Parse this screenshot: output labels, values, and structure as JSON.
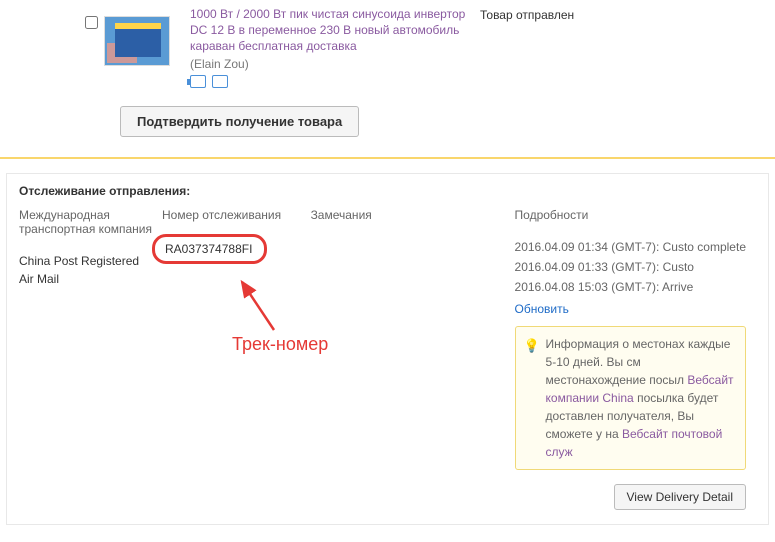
{
  "product": {
    "title": "1000 Вт / 2000 Вт пик чистая синусоида инвертор DC 12 В в переменное 230 В новый автомобиль караван бесплатная доставка",
    "seller": "(Elain Zou)",
    "status": "Товар отправлен"
  },
  "buttons": {
    "confirm_receipt": "Подтвердить получение товара",
    "view_delivery_detail": "View Delivery Detail"
  },
  "tracking": {
    "panel_title": "Отслеживание отправления:",
    "headers": {
      "company": "Международная транспортная компания",
      "number": "Номер отслеживания",
      "notes": "Замечания",
      "details": "Подробности"
    },
    "company": "China Post Registered Air Mail",
    "number": "RA037374788FI",
    "detail_lines": [
      "2016.04.09 01:34 (GMT-7): Custo complete",
      "2016.04.09 01:33 (GMT-7): Custo",
      "2016.04.08 15:03 (GMT-7): Arrive"
    ],
    "refresh": "Обновить",
    "info_text1": "Информация о местонах каждые 5-10 дней. Вы см местонахождение посыл",
    "info_link1": "Вебсайт компании China",
    "info_text2": "посылка будет доставлен получателя, Вы сможете у на",
    "info_link2": "Вебсайт почтовой служ"
  },
  "annotation": {
    "label": "Трек-номер"
  }
}
